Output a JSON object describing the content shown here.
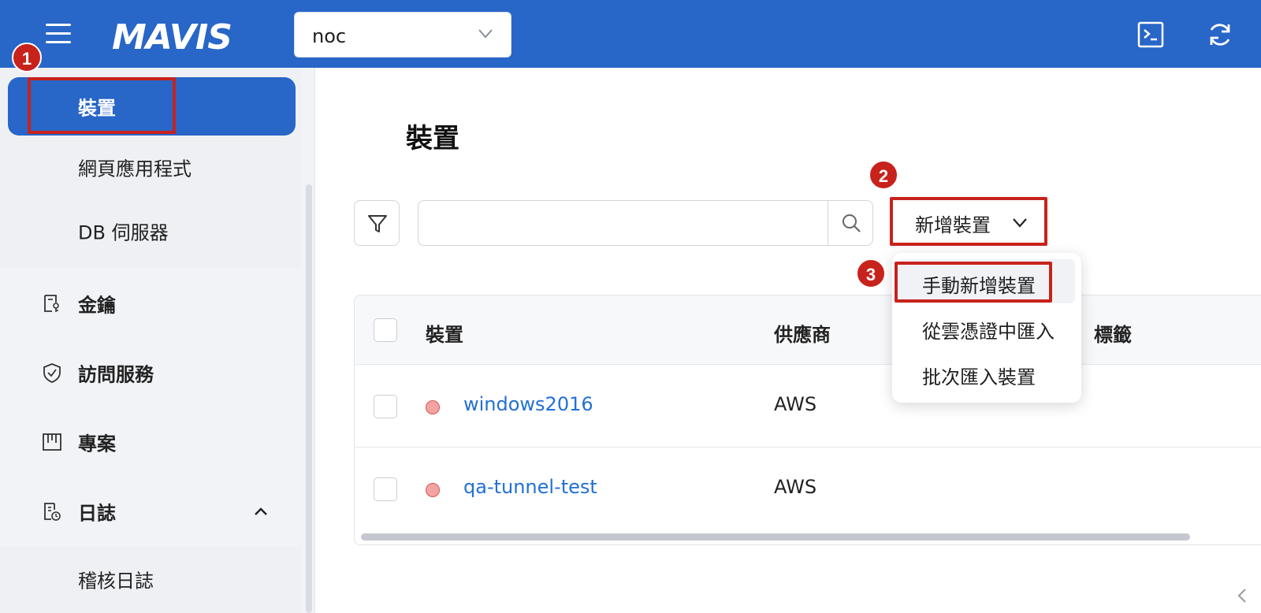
{
  "topbar": {
    "logo_text": "MAVIS",
    "env_select": {
      "value": "noc"
    },
    "colors": {
      "bar": "#2866c7"
    }
  },
  "sidebar": {
    "devices_group": [
      {
        "label": "裝置",
        "active": true
      },
      {
        "label": "網頁應用程式"
      },
      {
        "label": "DB 伺服器"
      }
    ],
    "sections": [
      {
        "label": "金鑰",
        "icon": "key-doc-icon"
      },
      {
        "label": "訪問服務",
        "icon": "shield-check-icon"
      },
      {
        "label": "專案",
        "icon": "kanban-icon"
      },
      {
        "label": "日誌",
        "icon": "log-clock-icon",
        "expanded": true
      }
    ],
    "log_group": [
      {
        "label": "稽核日誌"
      }
    ]
  },
  "main": {
    "title": "裝置",
    "search": {
      "placeholder": "",
      "value": ""
    },
    "add_button": {
      "label": "新增裝置"
    },
    "add_menu": [
      {
        "label": "手動新增裝置"
      },
      {
        "label": "從雲憑證中匯入"
      },
      {
        "label": "批次匯入裝置"
      }
    ],
    "table": {
      "headers": {
        "device": "裝置",
        "vendor": "供應商",
        "tags": "標籤"
      },
      "rows": [
        {
          "name": "windows2016",
          "vendor": "AWS",
          "status": "offline"
        },
        {
          "name": "qa-tunnel-test",
          "vendor": "AWS",
          "status": "offline"
        }
      ]
    }
  },
  "annotations": {
    "badges": [
      "1",
      "2",
      "3"
    ],
    "color": "#c8221c"
  }
}
